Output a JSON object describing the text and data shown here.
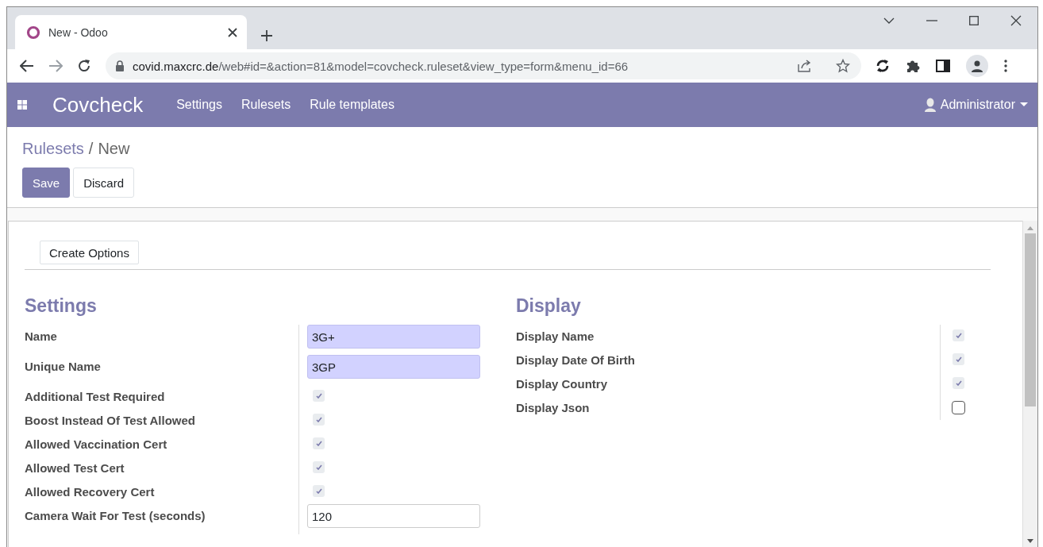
{
  "browser": {
    "tab_title": "New - Odoo",
    "url_host": "covid.maxcrc.de",
    "url_path": "/web#id=&action=81&model=covcheck.ruleset&view_type=form&menu_id=66"
  },
  "navbar": {
    "app_name": "Covcheck",
    "menu": [
      "Settings",
      "Rulesets",
      "Rule templates"
    ],
    "user": "Administrator"
  },
  "breadcrumb": {
    "parent": "Rulesets",
    "separator": "/",
    "current": "New"
  },
  "buttons": [
    {
      "label": "Save",
      "kind": "primary"
    },
    {
      "label": "Discard",
      "kind": "secondary"
    }
  ],
  "header_button": "Create Options",
  "groups": [
    {
      "title": "Settings",
      "fields": [
        {
          "label": "Name",
          "kind": "text",
          "value": "3G+",
          "required": true
        },
        {
          "label": "Unique Name",
          "kind": "text",
          "value": "3GP",
          "required": true
        },
        {
          "label": "Additional Test Required",
          "kind": "checkbox",
          "checked": true
        },
        {
          "label": "Boost Instead Of Test Allowed",
          "kind": "checkbox",
          "checked": true
        },
        {
          "label": "Allowed Vaccination Cert",
          "kind": "checkbox",
          "checked": true
        },
        {
          "label": "Allowed Test Cert",
          "kind": "checkbox",
          "checked": true
        },
        {
          "label": "Allowed Recovery Cert",
          "kind": "checkbox",
          "checked": true
        },
        {
          "label": "Camera Wait For Test (seconds)",
          "kind": "text",
          "value": "120",
          "required": false
        }
      ]
    },
    {
      "title": "Display",
      "fields": [
        {
          "label": "Display Name",
          "kind": "checkbox",
          "checked": true
        },
        {
          "label": "Display Date Of Birth",
          "kind": "checkbox",
          "checked": true
        },
        {
          "label": "Display Country",
          "kind": "checkbox",
          "checked": true
        },
        {
          "label": "Display Json",
          "kind": "checkbox",
          "checked": false
        }
      ]
    }
  ]
}
